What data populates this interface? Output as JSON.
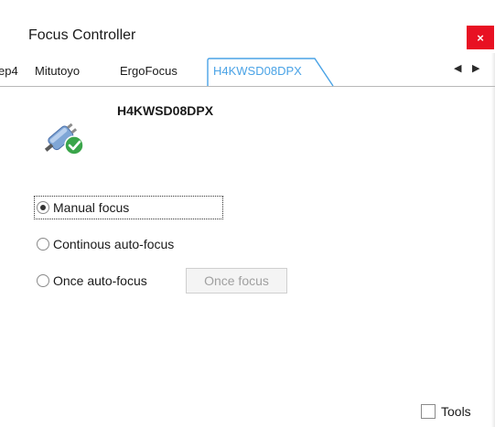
{
  "window": {
    "title": "Focus Controller",
    "close_glyph": "×"
  },
  "tabs": {
    "items": [
      {
        "label": "ep4"
      },
      {
        "label": "Mitutoyo"
      },
      {
        "label": "ErgoFocus"
      },
      {
        "label": "H4KWSD08DPX",
        "active": true
      }
    ],
    "scroll_left_glyph": "◀",
    "scroll_right_glyph": "▶"
  },
  "device": {
    "name": "H4KWSD08DPX",
    "icon": "connected-plug-check-icon"
  },
  "focus_modes": {
    "selected": "Manual focus",
    "options": [
      {
        "label": "Manual focus",
        "checked": true
      },
      {
        "label": "Continous auto-focus",
        "checked": false
      },
      {
        "label": "Once auto-focus",
        "checked": false
      }
    ],
    "once_button_label": "Once focus",
    "once_button_enabled": false
  },
  "tools": {
    "label": "Tools",
    "checked": false
  },
  "colors": {
    "close_red": "#e81123",
    "active_tab_text": "#4aa3e6",
    "active_tab_border": "#4aa3e6"
  }
}
